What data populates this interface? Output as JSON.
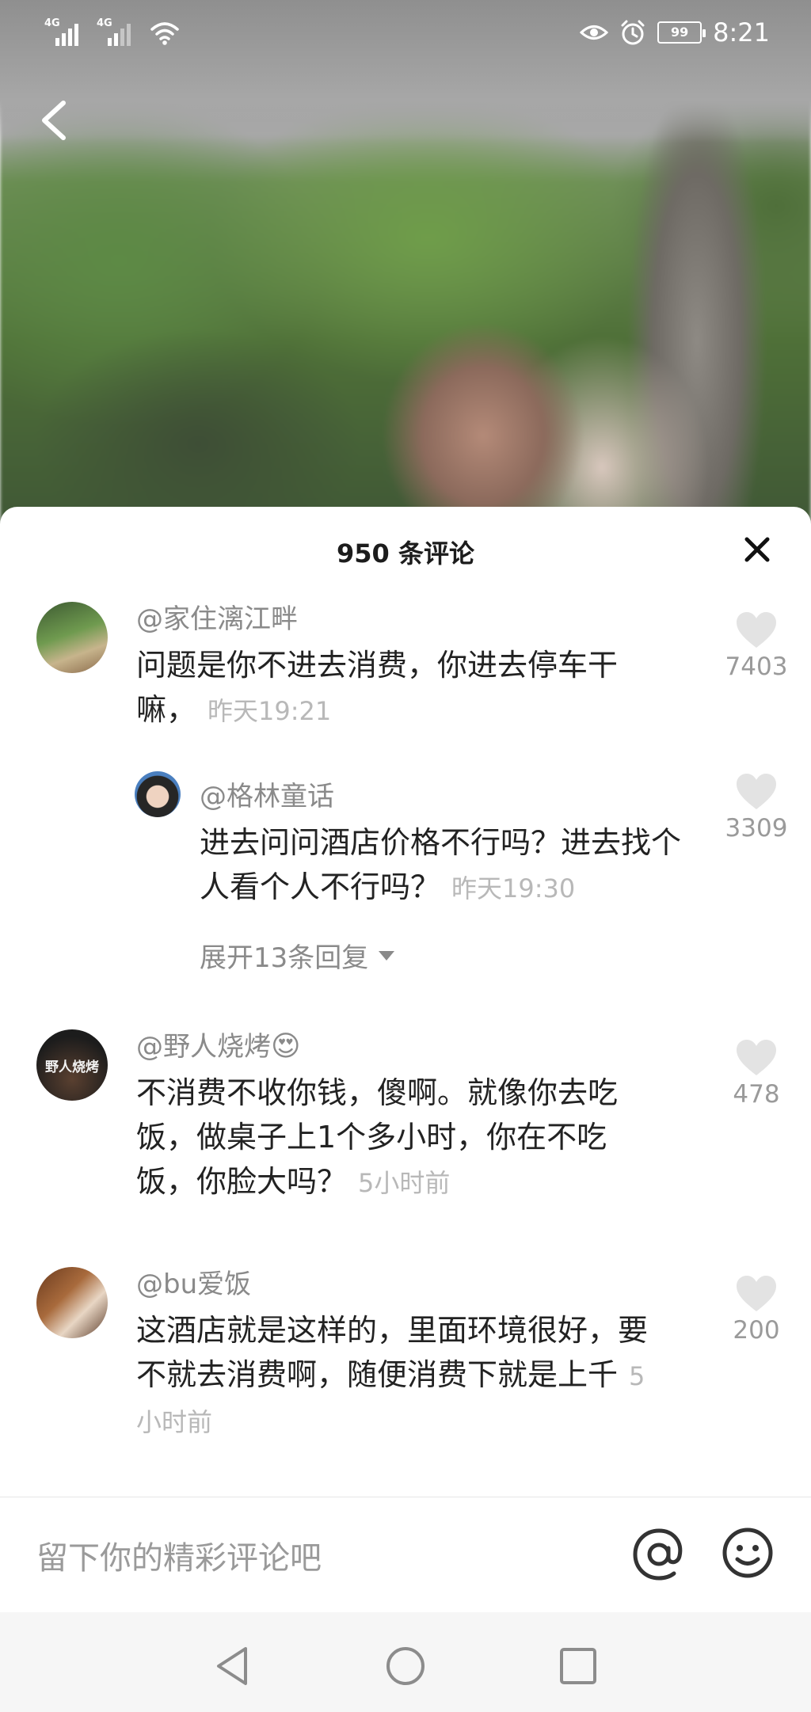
{
  "status_bar": {
    "signal1_tag": "4G",
    "signal2_tag": "4G",
    "battery": "99",
    "time": "8:21",
    "icons": [
      "signal-icon",
      "signal-icon",
      "wifi-icon",
      "eye-icon",
      "alarm-icon",
      "battery-icon"
    ]
  },
  "video": {
    "back_icon": "chevron-left-icon"
  },
  "sheet": {
    "title": "950 条评论",
    "close_icon": "close-icon"
  },
  "comments": [
    {
      "user": "@家住漓江畔",
      "text": "问题是你不进去消费，你进去停车干嘛，",
      "time": "昨天19:21",
      "likes": "7403",
      "avatar_colors": [
        "#5d7a4a",
        "#8fb06a",
        "#c9b38a"
      ]
    },
    {
      "user": "@格林童话",
      "text": "进去问问酒店价格不行吗？进去找个人看个人不行吗？",
      "time": "昨天19:30",
      "likes": "3309",
      "avatar_colors": [
        "#2a2a2a",
        "#e8c7b3",
        "#3a6fb0"
      ]
    },
    {
      "user": "@野人烧烤",
      "user_emoji": "😍",
      "avatar_text": "野人烧烤",
      "text": "不消费不收你钱，傻啊。就像你去吃饭，做桌子上1个多小时，你在不吃饭，你脸大吗？",
      "time": "5小时前",
      "likes": "478",
      "avatar_colors": [
        "#1a1a1a",
        "#3b2a20",
        "#d9d9d9"
      ]
    },
    {
      "user": "@bu爱饭",
      "text": "这酒店就是这样的，里面环境很好，要不就去消费啊，随便消费下就是上千",
      "time": "5小时前",
      "likes": "200",
      "avatar_colors": [
        "#7a4a2a",
        "#c88c5a",
        "#f0e0d0"
      ]
    }
  ],
  "expand_replies": "展开13条回复",
  "input": {
    "placeholder": "留下你的精彩评论吧",
    "at_icon": "at-icon",
    "emoji_icon": "emoji-icon"
  },
  "nav": [
    "back-triangle-icon",
    "home-circle-icon",
    "recents-square-icon"
  ],
  "colors": {
    "text_primary": "#222222",
    "text_secondary": "#8a8a8a",
    "text_time": "#b8b8b8",
    "heart": "#e3e3e3"
  }
}
